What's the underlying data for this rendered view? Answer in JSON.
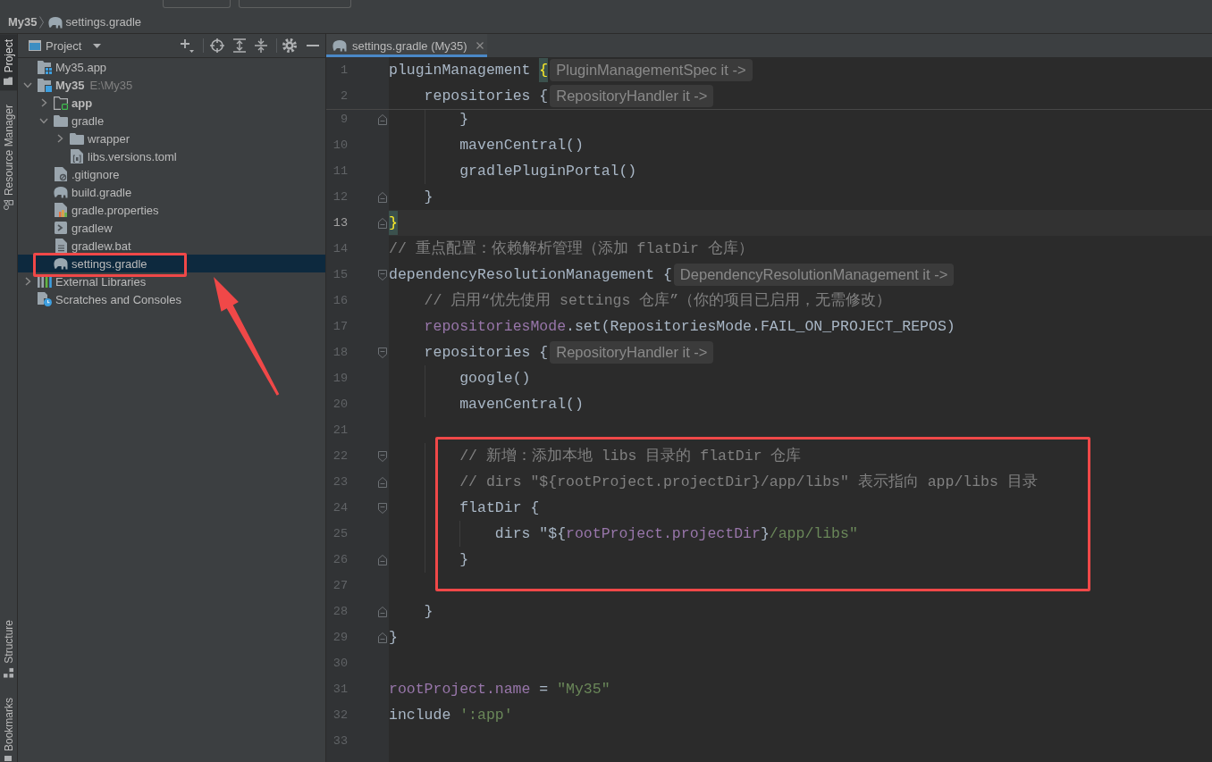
{
  "breadcrumbs": [
    {
      "label": "My35",
      "kind": "project"
    },
    {
      "label": "settings.gradle",
      "kind": "gradle"
    }
  ],
  "tool_stripe": {
    "top": [
      {
        "label": "Project",
        "kind": "project",
        "selected": true
      },
      {
        "label": "Resource Manager",
        "kind": "resources",
        "selected": false
      }
    ],
    "bottom": [
      {
        "label": "Structure",
        "kind": "structure",
        "selected": false
      },
      {
        "label": "Bookmarks",
        "kind": "bookmarks",
        "selected": false
      }
    ]
  },
  "project_panel": {
    "title": "Project",
    "tree": [
      {
        "label": "My35.app",
        "kind": "module",
        "bold": false,
        "selected": false,
        "annotated": false
      },
      {
        "label": "My35",
        "hint": "E:\\My35",
        "kind": "project",
        "bold": true,
        "expanded": true,
        "selected": false,
        "annotated": false,
        "children": [
          {
            "label": "app",
            "kind": "module-folder",
            "bold": true,
            "expanded": false,
            "selected": false,
            "annotated": false
          },
          {
            "label": "gradle",
            "kind": "folder",
            "bold": false,
            "expanded": true,
            "selected": false,
            "annotated": false,
            "children": [
              {
                "label": "wrapper",
                "kind": "folder",
                "bold": false,
                "expanded": false,
                "selected": false,
                "annotated": false
              },
              {
                "label": "libs.versions.toml",
                "kind": "toml",
                "bold": false,
                "selected": false,
                "annotated": false
              }
            ]
          },
          {
            "label": ".gitignore",
            "kind": "ignore",
            "bold": false,
            "selected": false,
            "annotated": false
          },
          {
            "label": "build.gradle",
            "kind": "gradle",
            "bold": false,
            "selected": false,
            "annotated": false
          },
          {
            "label": "gradle.properties",
            "kind": "properties",
            "bold": false,
            "selected": false,
            "annotated": false
          },
          {
            "label": "gradlew",
            "kind": "script",
            "bold": false,
            "selected": false,
            "annotated": false
          },
          {
            "label": "gradlew.bat",
            "kind": "text",
            "bold": false,
            "selected": false,
            "annotated": false
          },
          {
            "label": "settings.gradle",
            "kind": "gradle",
            "bold": false,
            "selected": true,
            "annotated": true
          }
        ]
      },
      {
        "label": "External Libraries",
        "kind": "libraries",
        "bold": false,
        "expanded": false,
        "selected": false,
        "annotated": false
      },
      {
        "label": "Scratches and Consoles",
        "kind": "scratches",
        "bold": false,
        "selected": false,
        "annotated": false
      }
    ]
  },
  "editor": {
    "tabs": [
      {
        "label": "settings.gradle (My35)",
        "kind": "gradle",
        "selected": true
      }
    ],
    "sticky_lines": [
      {
        "number": "1",
        "tokens": [
          {
            "text": "pluginManagement ",
            "kind": "plain"
          },
          {
            "text": "{",
            "kind": "brace-match"
          }
        ],
        "hint": "PluginManagementSpec it ->"
      },
      {
        "number": "2",
        "tokens": [
          {
            "text": "    repositories {",
            "kind": "plain"
          }
        ],
        "hint": "RepositoryHandler it ->"
      }
    ],
    "lines": [
      {
        "number": "9",
        "kind": "fold-end",
        "tokens": [
          {
            "text": "        }",
            "kind": "plain"
          }
        ],
        "current": false,
        "boxed": false
      },
      {
        "number": "10",
        "kind": "plain",
        "tokens": [
          {
            "text": "        mavenCentral()",
            "kind": "plain"
          }
        ],
        "current": false,
        "boxed": false
      },
      {
        "number": "11",
        "kind": "plain",
        "tokens": [
          {
            "text": "        gradlePluginPortal()",
            "kind": "plain"
          }
        ],
        "current": false,
        "boxed": false
      },
      {
        "number": "12",
        "kind": "fold-end",
        "tokens": [
          {
            "text": "    }",
            "kind": "plain"
          }
        ],
        "current": false,
        "boxed": false
      },
      {
        "number": "13",
        "kind": "fold-end",
        "tokens": [
          {
            "text": "}",
            "kind": "brace-match"
          }
        ],
        "current": true,
        "boxed": false
      },
      {
        "number": "14",
        "kind": "plain",
        "tokens": [
          {
            "text": "// 重点配置：依赖解析管理（添加 flatDir 仓库）",
            "kind": "comment"
          }
        ],
        "current": false,
        "boxed": false
      },
      {
        "number": "15",
        "kind": "fold-start",
        "tokens": [
          {
            "text": "dependencyResolutionManagement {",
            "kind": "plain"
          }
        ],
        "hint": "DependencyResolutionManagement it ->",
        "current": false,
        "boxed": false
      },
      {
        "number": "16",
        "kind": "plain",
        "tokens": [
          {
            "text": "    // 启用“优先使用 settings 仓库”（你的项目已启用，无需修改）",
            "kind": "comment"
          }
        ],
        "current": false,
        "boxed": false
      },
      {
        "number": "17",
        "kind": "plain",
        "tokens": [
          {
            "text": "    repositoriesMode",
            "kind": "field"
          },
          {
            "text": ".set(RepositoriesMode.FAIL_ON_PROJECT_REPOS)",
            "kind": "plain"
          }
        ],
        "current": false,
        "boxed": false
      },
      {
        "number": "18",
        "kind": "fold-start",
        "tokens": [
          {
            "text": "    repositories {",
            "kind": "plain"
          }
        ],
        "hint": "RepositoryHandler it ->",
        "current": false,
        "boxed": false
      },
      {
        "number": "19",
        "kind": "plain",
        "tokens": [
          {
            "text": "        google()",
            "kind": "plain"
          }
        ],
        "current": false,
        "boxed": false
      },
      {
        "number": "20",
        "kind": "plain",
        "tokens": [
          {
            "text": "        mavenCentral()",
            "kind": "plain"
          }
        ],
        "current": false,
        "boxed": false
      },
      {
        "number": "21",
        "kind": "plain",
        "current": false,
        "boxed": false
      },
      {
        "number": "22",
        "kind": "fold-start",
        "tokens": [
          {
            "text": "        // 新增：添加本地 libs 目录的 flatDir 仓库",
            "kind": "comment"
          }
        ],
        "current": false,
        "boxed": true
      },
      {
        "number": "23",
        "kind": "fold-end",
        "tokens": [
          {
            "text": "        // dirs \"${rootProject.projectDir}/app/libs\" 表示指向 app/libs 目录",
            "kind": "comment"
          }
        ],
        "current": false,
        "boxed": true
      },
      {
        "number": "24",
        "kind": "fold-start",
        "tokens": [
          {
            "text": "        flatDir {",
            "kind": "plain"
          }
        ],
        "current": false,
        "boxed": true
      },
      {
        "number": "25",
        "kind": "plain",
        "tokens": [
          {
            "text": "            dirs \"${",
            "kind": "plain"
          },
          {
            "text": "rootProject.projectDir",
            "kind": "field"
          },
          {
            "text": "}",
            "kind": "plain"
          },
          {
            "text": "/app/libs\"",
            "kind": "string"
          }
        ],
        "current": false,
        "boxed": true
      },
      {
        "number": "26",
        "kind": "fold-end",
        "tokens": [
          {
            "text": "        }",
            "kind": "plain"
          }
        ],
        "current": false,
        "boxed": true
      },
      {
        "number": "27",
        "kind": "plain",
        "current": false,
        "boxed": true
      },
      {
        "number": "28",
        "kind": "fold-end",
        "tokens": [
          {
            "text": "    }",
            "kind": "plain"
          }
        ],
        "current": false,
        "boxed": false
      },
      {
        "number": "29",
        "kind": "fold-end",
        "tokens": [
          {
            "text": "}",
            "kind": "plain"
          }
        ],
        "current": false,
        "boxed": false
      },
      {
        "number": "30",
        "kind": "plain",
        "current": false,
        "boxed": false
      },
      {
        "number": "31",
        "kind": "plain",
        "tokens": [
          {
            "text": "rootProject.name",
            "kind": "field"
          },
          {
            "text": " = ",
            "kind": "plain"
          },
          {
            "text": "\"My35\"",
            "kind": "string"
          }
        ],
        "current": false,
        "boxed": false
      },
      {
        "number": "32",
        "kind": "plain",
        "tokens": [
          {
            "text": "include ",
            "kind": "plain"
          },
          {
            "text": "':app'",
            "kind": "string"
          }
        ],
        "current": false,
        "boxed": false
      },
      {
        "number": "33",
        "kind": "plain",
        "current": false,
        "boxed": false
      }
    ]
  }
}
